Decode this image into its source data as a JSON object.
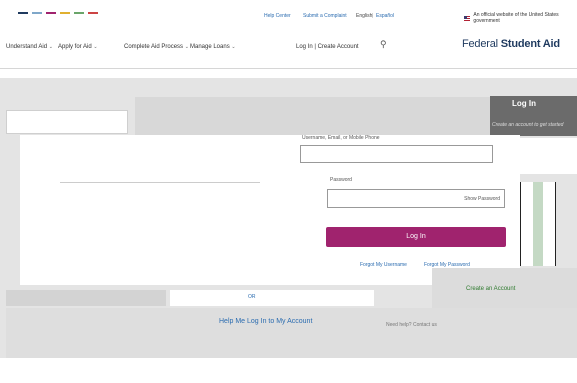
{
  "utility_bar": {
    "help_center": "Help Center",
    "submit_complaint": "Submit a Complaint",
    "english": "English",
    "separator": "|",
    "espanol": "Español",
    "gov_notice": "An official website of the United States government",
    "stripe_colors": [
      "#1f3a5f",
      "#7fa7c9",
      "#a0236e",
      "#e0b030",
      "#6aa56a",
      "#c44"
    ]
  },
  "nav": {
    "items": [
      "Understand Aid",
      "Apply for Aid",
      "Complete Aid Process",
      "Manage Loans"
    ],
    "log_in_label": "Log In | Create Account",
    "search_icon": "search-icon",
    "brand_normal": "Federal ",
    "brand_bold": "Student Aid"
  },
  "hero": {
    "dark_label": "Log In",
    "dark_italic": "Create an account to get started"
  },
  "login": {
    "title": "Username, Email, or Mobile Phone",
    "password_label": "Password",
    "show_password": "Show Password",
    "login_button": "Log In",
    "forgot_username": "Forgot My Username",
    "forgot_password": "Forgot My Password"
  },
  "lower": {
    "or_text": "OR",
    "create_account": "Create an Account",
    "help_link": "Help Me Log In to My Account",
    "small_note": "Need help? Contact us"
  },
  "colors": {
    "login_button": "#a0236e",
    "link": "#2b6cb0",
    "brand": "#1f3a5f",
    "create_green": "#2f7a2f"
  }
}
